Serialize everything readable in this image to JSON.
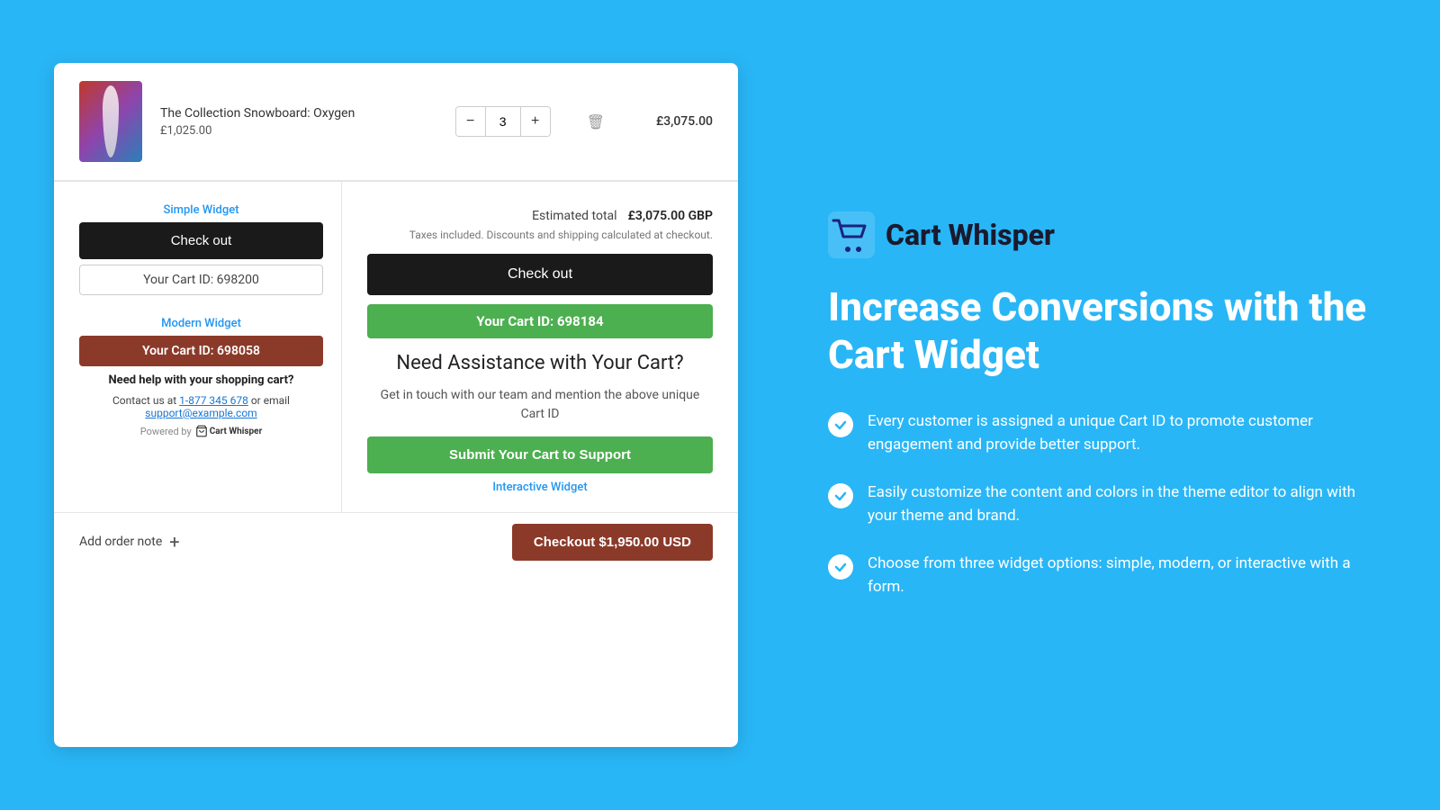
{
  "left": {
    "product": {
      "name": "The Collection Snowboard: Oxygen",
      "unit_price": "£1,025.00",
      "quantity": "3",
      "total": "£3,075.00"
    },
    "estimated": {
      "label": "Estimated total",
      "value": "£3,075.00 GBP",
      "tax_note": "Taxes included. Discounts and shipping calculated at checkout."
    },
    "simple_widget": {
      "label": "Simple Widget",
      "checkout_label": "Check out",
      "cart_id_label": "Your Cart ID: 698200"
    },
    "modern_widget": {
      "label": "Modern Widget",
      "cart_id_label": "Your Cart ID: 698058",
      "need_help": "Need help with your shopping cart?",
      "contact": "Contact us at 1-877 345 678 or email support@example.com",
      "phone": "1-877 345 678",
      "email": "support@example.com",
      "powered_by": "Powered by",
      "powered_name": "Cart Whisper"
    },
    "checkout_btn": {
      "label": "Check out"
    },
    "interactive_widget": {
      "label": "Interactive Widget",
      "cart_id_label": "Your Cart ID: 698184",
      "title": "Need Assistance with Your Cart?",
      "subtitle": "Get in touch with our team and mention the above unique Cart ID",
      "submit_label": "Submit Your Cart to Support"
    },
    "bottom": {
      "add_note": "Add order note",
      "checkout_label": "Checkout $1,950.00 USD"
    }
  },
  "right": {
    "brand": {
      "name": "Cart Whisper"
    },
    "headline": "Increase Conversions with the Cart Widget",
    "features": [
      {
        "text": "Every customer is assigned a unique Cart ID to promote customer engagement and provide better support."
      },
      {
        "text": "Easily customize the content and colors in the theme editor to align with your theme and brand."
      },
      {
        "text": "Choose from three widget options: simple, modern, or interactive with a form."
      }
    ]
  }
}
